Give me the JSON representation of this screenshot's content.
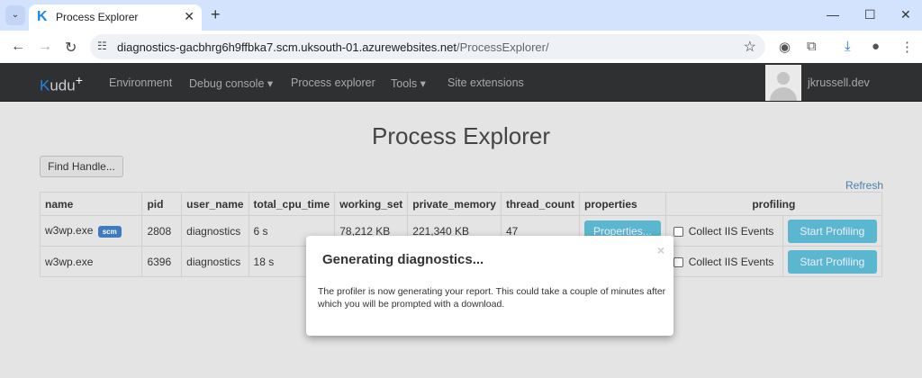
{
  "browser": {
    "tab_title": "Process Explorer",
    "url_host": "diagnostics-gacbhrg6h9ffbka7.scm.uksouth-01.azurewebsites.net",
    "url_path": "/ProcessExplorer/"
  },
  "navbar": {
    "brand": "udu",
    "brand_k": "K",
    "brand_plus": "+",
    "items": [
      {
        "label": "Environment"
      },
      {
        "label": "Debug console ▾"
      },
      {
        "label": "Process explorer"
      },
      {
        "label": "Tools ▾"
      },
      {
        "label": "Site extensions"
      }
    ],
    "username": "jkrussell.dev"
  },
  "page": {
    "title": "Process Explorer",
    "find_handle": "Find Handle...",
    "refresh": "Refresh"
  },
  "table": {
    "headers": [
      "name",
      "pid",
      "user_name",
      "total_cpu_time",
      "working_set",
      "private_memory",
      "thread_count",
      "properties",
      "profiling"
    ],
    "rows": [
      {
        "name": "w3wp.exe",
        "badge": "scm",
        "pid": "2808",
        "user_name": "diagnostics",
        "total_cpu_time": "6 s",
        "working_set": "78,212 KB",
        "private_memory": "221,340 KB",
        "thread_count": "47",
        "properties": "Properties...",
        "collect": "Collect IIS Events",
        "profile": "Start Profiling"
      },
      {
        "name": "w3wp.exe",
        "pid": "6396",
        "user_name": "diagnostics",
        "total_cpu_time": "18 s",
        "collect": "Collect IIS Events",
        "profile": "Start Profiling"
      }
    ]
  },
  "modal": {
    "title": "Generating diagnostics...",
    "body": "The profiler is now generating your report. This could take a couple of minutes after which you will be prompted with a download.",
    "close": "×"
  },
  "colors": {
    "accent": "#5bb7cf",
    "navbar": "#2f3032",
    "badge": "#3c7bc4"
  }
}
